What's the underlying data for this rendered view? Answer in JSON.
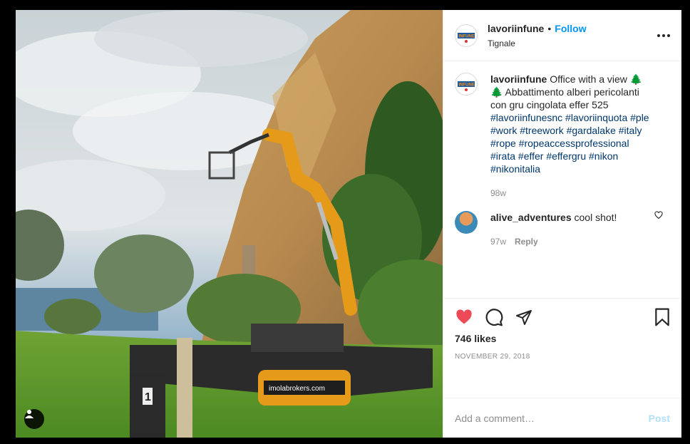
{
  "header": {
    "username": "lavoriinfune",
    "dot": "•",
    "follow_label": "Follow",
    "location": "Tignale",
    "logo_text": "INFUNE"
  },
  "caption": {
    "username": "lavoriinfune",
    "text": "Office with a view 🌲🌲 Abbattimento alberi pericolanti con gru cingolata effer 525",
    "hashtags": "#lavoriinfunesnc #lavoriinquota #ple #work #treework #gardalake #italy #rope #ropeaccessprofessional #irata #effer #effergru #nikon #nikonitalia",
    "time": "98w"
  },
  "comment": {
    "username": "alive_adventures",
    "text": "cool shot!",
    "time": "97w",
    "reply_label": "Reply"
  },
  "likes": "746 likes",
  "date": "NOVEMBER 29, 2018",
  "add_comment": {
    "placeholder": "Add a comment…",
    "post_label": "Post"
  },
  "photo": {
    "truck_text": "imolabrokers.com",
    "sign_number": "1"
  },
  "colors": {
    "follow": "#0095f6",
    "heart": "#ed4956",
    "hashtag": "#00376b",
    "post_disabled": "#b2dffc"
  }
}
